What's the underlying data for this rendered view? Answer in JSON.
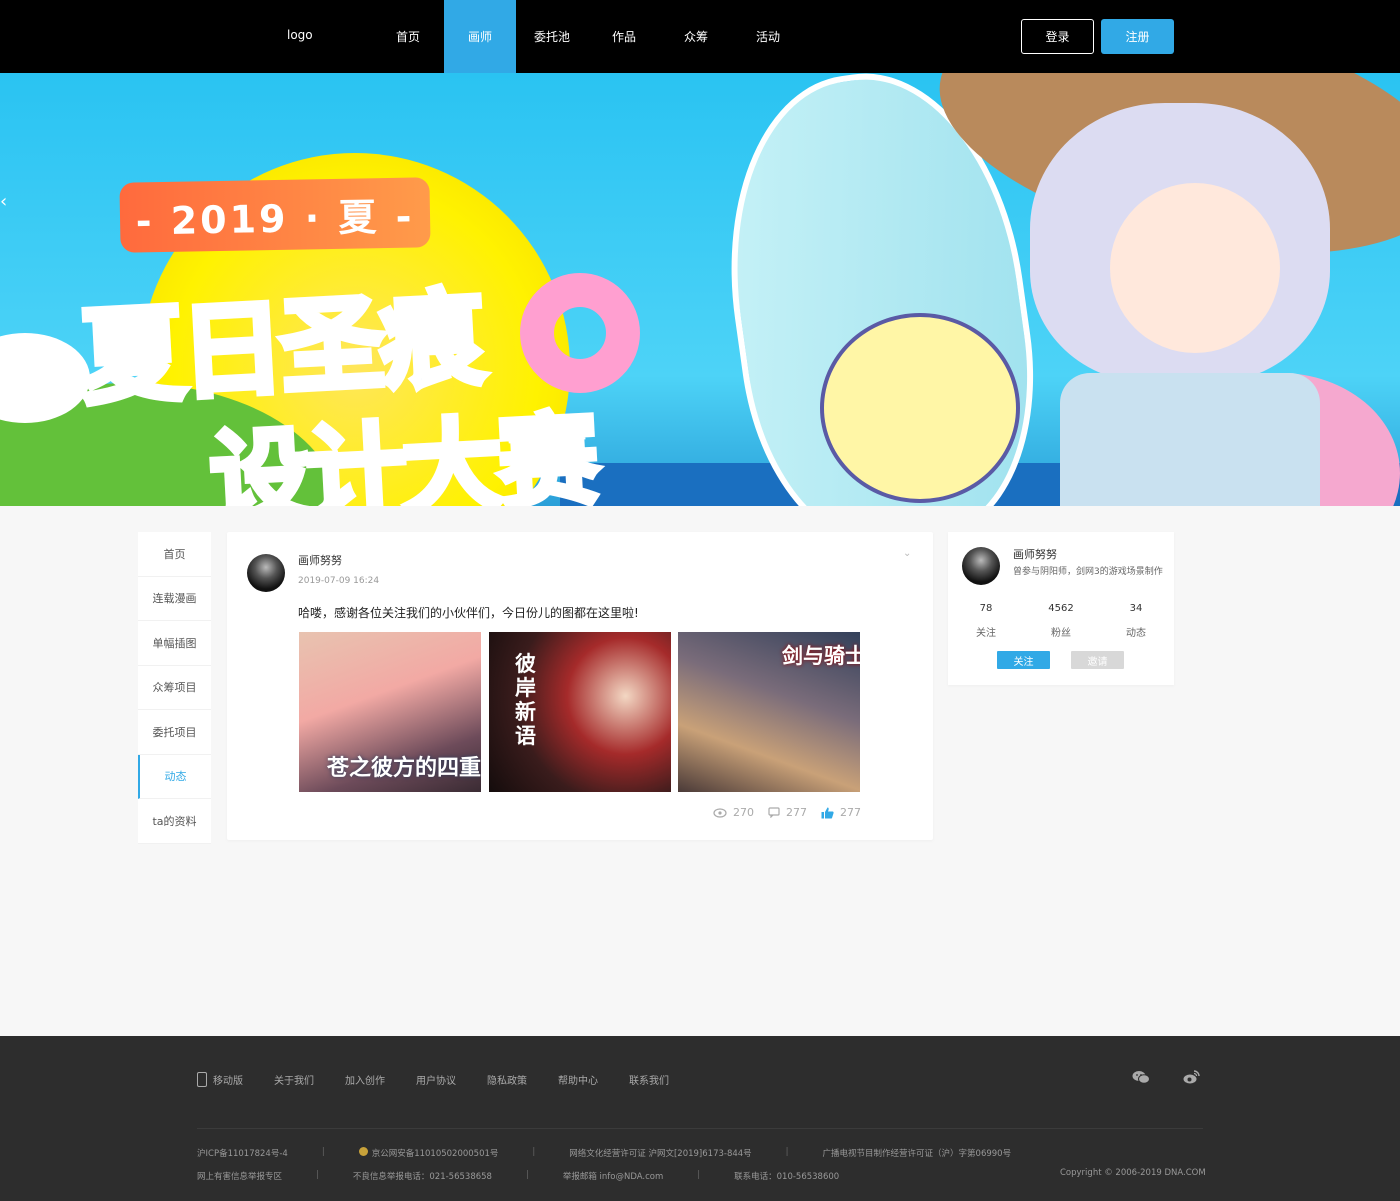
{
  "header": {
    "logo": "logo",
    "nav": [
      {
        "label": "首页",
        "active": false
      },
      {
        "label": "画师",
        "active": true
      },
      {
        "label": "委托池",
        "active": false
      },
      {
        "label": "作品",
        "active": false
      },
      {
        "label": "众筹",
        "active": false
      },
      {
        "label": "活动",
        "active": false
      }
    ],
    "login_label": "登录",
    "register_label": "注册"
  },
  "banner": {
    "year_text": "- 2019 · 夏 -",
    "title_line1": "夏日圣痕",
    "title_line2": "设计大赛",
    "prev_arrow": "‹"
  },
  "side_menu": {
    "items": [
      "首页",
      "连载漫画",
      "单幅插图",
      "众筹项目",
      "委托项目",
      "动态",
      "ta的资料"
    ],
    "active_index": 5
  },
  "post": {
    "author": "画师努努",
    "time": "2019-07-09 16:24",
    "caret": "⌄",
    "text": "哈喽，感谢各位关注我们的小伙伴们，今日份儿的图都在这里啦!",
    "images": [
      {
        "caption": "苍之彼方的四重"
      },
      {
        "caption": "彼岸新语"
      },
      {
        "caption": "剑与骑士"
      }
    ],
    "views": "270",
    "comments": "277",
    "likes": "277"
  },
  "profile": {
    "name": "画师努努",
    "desc": "曾参与阴阳师，剑网3的游戏场景制作",
    "stats": [
      {
        "value": "78",
        "label": "关注"
      },
      {
        "value": "4562",
        "label": "粉丝"
      },
      {
        "value": "34",
        "label": "动态"
      }
    ],
    "follow_label": "关注",
    "invite_label": "邀请"
  },
  "footer": {
    "links": [
      "移动版",
      "关于我们",
      "加入创作",
      "用户协议",
      "隐私政策",
      "帮助中心",
      "联系我们"
    ],
    "row1": [
      "沪ICP备11017824号-4",
      "京公网安备11010502000501号",
      "网络文化经营许可证 沪网文[2019]6173-844号",
      "广播电视节目制作经营许可证（沪）字第06990号"
    ],
    "row2": [
      "网上有害信息举报专区",
      "不良信息举报电话：021-56538658",
      "举报邮箱 info@NDA.com",
      "联系电话：010-56538600"
    ],
    "copyright": "Copyright © 2006-2019 DNA.COM"
  },
  "colors": {
    "accent": "#31a9e6",
    "header_bg": "#000000",
    "footer_bg": "#2d2d2d"
  }
}
